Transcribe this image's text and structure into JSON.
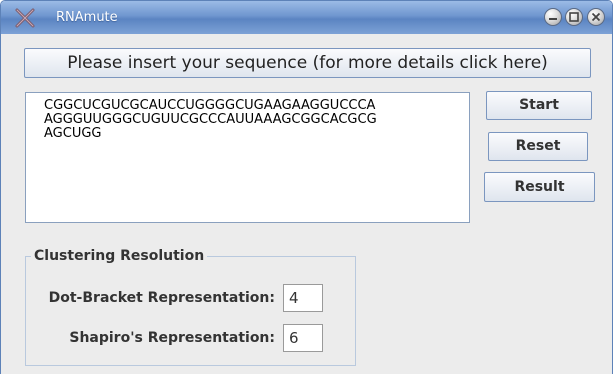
{
  "window": {
    "title": "RNAmute",
    "controls": [
      "minimize-icon",
      "maximize-icon",
      "close-icon"
    ]
  },
  "prompt": {
    "label": "Please insert your sequence (for more details click here)"
  },
  "sequence": {
    "lines": [
      "CGGCUCGUCGCAUCCUGGGGCUGAAGAAGGUCCCA",
      "AGGGUUGGGCUGUUCGCCCAUUAAAGCGGCACGCG",
      "AGCUGG"
    ]
  },
  "actions": {
    "start_label": "Start",
    "reset_label": "Reset",
    "result_label": "Result"
  },
  "clustering": {
    "title": "Clustering Resolution",
    "dot_bracket_label": "Dot-Bracket Representation:",
    "dot_bracket_value": "4",
    "shapiro_label": "Shapiro's Representation:",
    "shapiro_value": "6"
  },
  "colors": {
    "titlebar": "#6f96cf",
    "button_border": "#7b96bf",
    "panel_background": "#ececec"
  }
}
